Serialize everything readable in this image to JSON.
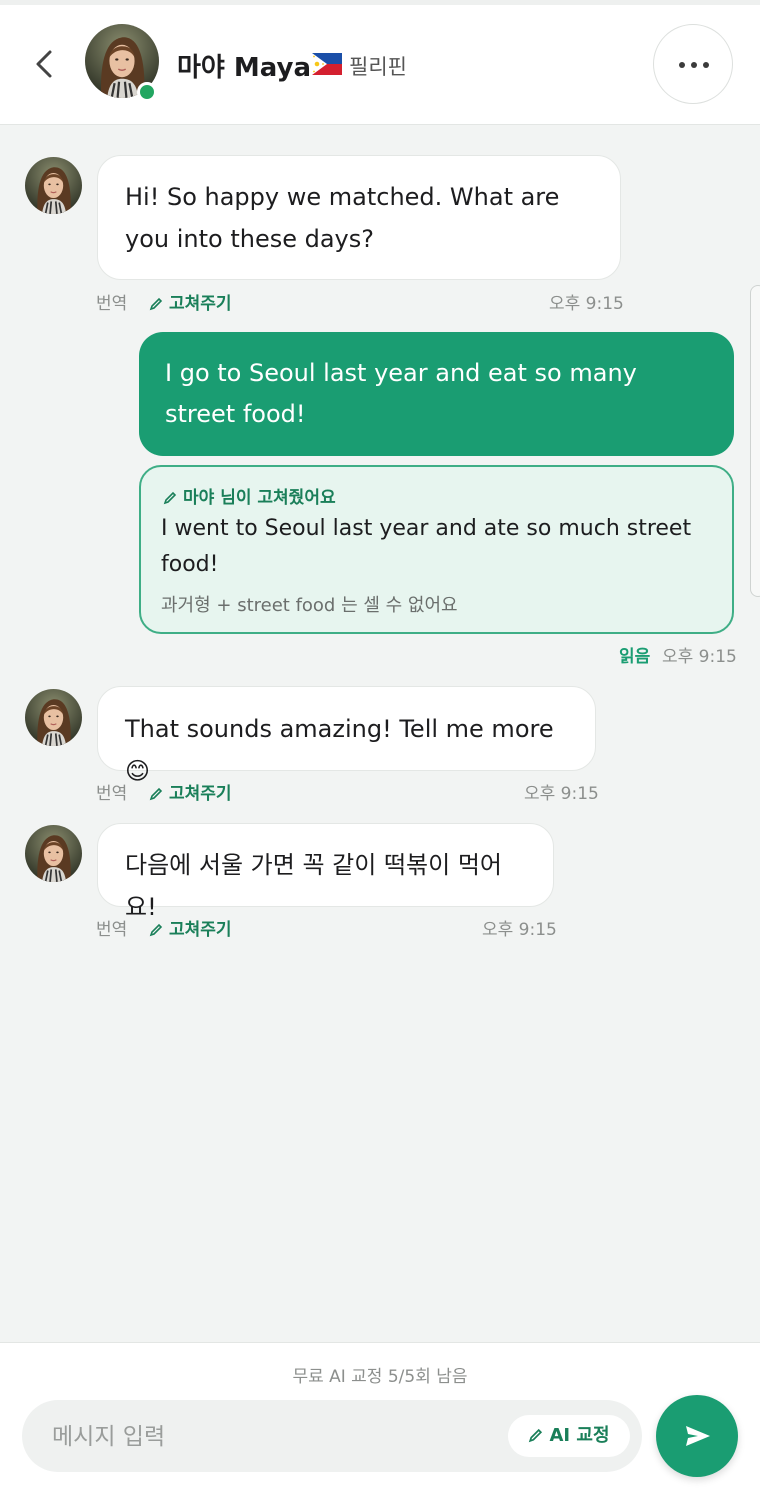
{
  "header": {
    "name": "마야 Maya",
    "country": "필리핀",
    "flag_icon": "philippines-flag-icon",
    "online": true
  },
  "messages": [
    {
      "from": "partner",
      "text": "Hi! So happy we matched. What are you into these days?",
      "translate": "번역",
      "fix": "고쳐주기",
      "time": "오후 9:15"
    },
    {
      "from": "me",
      "text": "I go to Seoul last year and eat so many street food!",
      "correction": {
        "title": "마야 님이 고쳐줬어요",
        "text": "I went to Seoul last year and ate so much street food!",
        "note": "과거형 + street food 는 셀 수 없어요"
      },
      "read": "읽음",
      "time": "오후 9:15"
    },
    {
      "from": "partner",
      "text": "That sounds amazing! Tell me more 😊",
      "translate": "번역",
      "fix": "고쳐주기",
      "time": "오후 9:15"
    },
    {
      "from": "partner",
      "text": "다음에 서울 가면 꼭 같이 떡볶이 먹어요!",
      "translate": "번역",
      "fix": "고쳐주기",
      "time": "오후 9:15"
    }
  ],
  "composer": {
    "quota": "무료 AI 교정 5/5회 남음",
    "placeholder": "메시지 입력",
    "ai_button": "AI 교정"
  },
  "colors": {
    "accent": "#1a9d72",
    "accent_dark": "#1a7f59",
    "correction_bg": "#e7f5ef",
    "online": "#22a661"
  }
}
